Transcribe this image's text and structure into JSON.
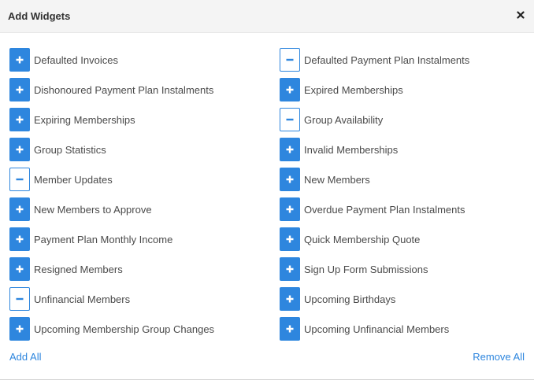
{
  "modal": {
    "title": "Add Widgets",
    "close_icon": "close-icon"
  },
  "colors": {
    "accent": "#2e86de",
    "header_bg": "#f4f4f4",
    "text": "#4a4a4a"
  },
  "widgets_left": [
    {
      "label": "Defaulted Invoices",
      "state": "add"
    },
    {
      "label": "Dishonoured Payment Plan Instalments",
      "state": "add"
    },
    {
      "label": "Expiring Memberships",
      "state": "add"
    },
    {
      "label": "Group Statistics",
      "state": "add"
    },
    {
      "label": "Member Updates",
      "state": "remove"
    },
    {
      "label": "New Members to Approve",
      "state": "add"
    },
    {
      "label": "Payment Plan Monthly Income",
      "state": "add"
    },
    {
      "label": "Resigned Members",
      "state": "add"
    },
    {
      "label": "Unfinancial Members",
      "state": "remove"
    },
    {
      "label": "Upcoming Membership Group Changes",
      "state": "add"
    }
  ],
  "widgets_right": [
    {
      "label": "Defaulted Payment Plan Instalments",
      "state": "remove"
    },
    {
      "label": "Expired Memberships",
      "state": "add"
    },
    {
      "label": "Group Availability",
      "state": "remove"
    },
    {
      "label": "Invalid Memberships",
      "state": "add"
    },
    {
      "label": "New Members",
      "state": "add"
    },
    {
      "label": "Overdue Payment Plan Instalments",
      "state": "add"
    },
    {
      "label": "Quick Membership Quote",
      "state": "add"
    },
    {
      "label": "Sign Up Form Submissions",
      "state": "add"
    },
    {
      "label": "Upcoming Birthdays",
      "state": "add"
    },
    {
      "label": "Upcoming Unfinancial Members",
      "state": "add"
    }
  ],
  "footer": {
    "add_all": "Add All",
    "remove_all": "Remove All"
  }
}
